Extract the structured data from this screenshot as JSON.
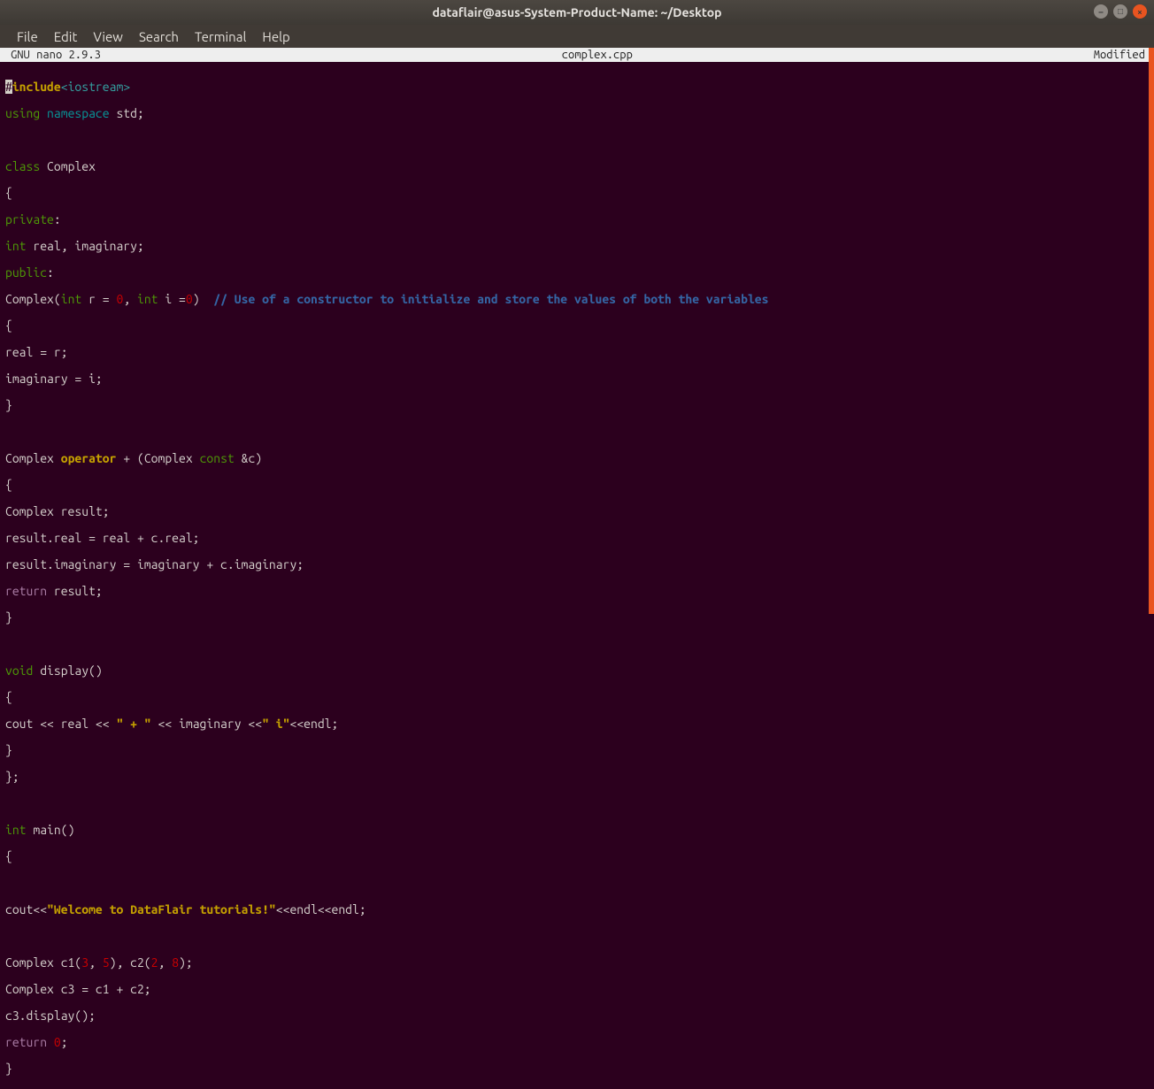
{
  "window": {
    "title": "dataflair@asus-System-Product-Name: ~/Desktop"
  },
  "menu": {
    "file": "File",
    "edit": "Edit",
    "view": "View",
    "search": "Search",
    "terminal": "Terminal",
    "help": "Help"
  },
  "nano": {
    "version": "GNU nano 2.9.3",
    "filename": "complex.cpp",
    "modified": "Modified"
  },
  "code": {
    "l1_hash": "#",
    "l1_inc": "include",
    "l1_hdr": "<iostream>",
    "l2_using": "using",
    "l2_ns": " namespace",
    "l2_std": " std;",
    "l4_class": "class",
    "l4_name": " Complex",
    "l5": "{",
    "l6_priv": "private",
    "l6_colon": ":",
    "l7_int": "int",
    "l7_rest": " real, imaginary;",
    "l8_pub": "public",
    "l8_colon": ":",
    "l9_a": "Complex(",
    "l9_int1": "int",
    "l9_b": " r = ",
    "l9_z1": "0",
    "l9_c": ", ",
    "l9_int2": "int",
    "l9_d": " i =",
    "l9_z2": "0",
    "l9_e": ")  ",
    "l9_cmt": "// Use of a constructor to initialize and store the values of both the variables",
    "l10": "{",
    "l11": "real = r;",
    "l12": "imaginary = i;",
    "l13": "}",
    "l15a": "Complex ",
    "l15op": "operator",
    "l15b": " + (Complex ",
    "l15const": "const",
    "l15c": " &c)",
    "l16": "{",
    "l17": "Complex result;",
    "l18": "result.real = real + c.real;",
    "l19": "result.imaginary = imaginary + c.imaginary;",
    "l20ret": "return",
    "l20b": " result;",
    "l21": "}",
    "l23void": "void",
    "l23b": " display()",
    "l24": "{",
    "l25a": "cout << real << ",
    "l25s1": "\" + \"",
    "l25b": " << imaginary <<",
    "l25s2": "\" i\"",
    "l25c": "<<endl;",
    "l26": "}",
    "l27": "};",
    "l29int": "int",
    "l29b": " main()",
    "l30": "{",
    "l32a": "cout<<",
    "l32s": "\"Welcome to DataFlair tutorials!\"",
    "l32b": "<<endl<<endl;",
    "l34a": "Complex c1(",
    "l34n1": "3",
    "l34b": ", ",
    "l34n2": "5",
    "l34c": "), c2(",
    "l34n3": "2",
    "l34d": ", ",
    "l34n4": "8",
    "l34e": ");",
    "l35": "Complex c3 = c1 + c2;",
    "l36": "c3.display();",
    "l37ret": "return",
    "l37sp": " ",
    "l37n": "0",
    "l37b": ";",
    "l38": "}"
  }
}
